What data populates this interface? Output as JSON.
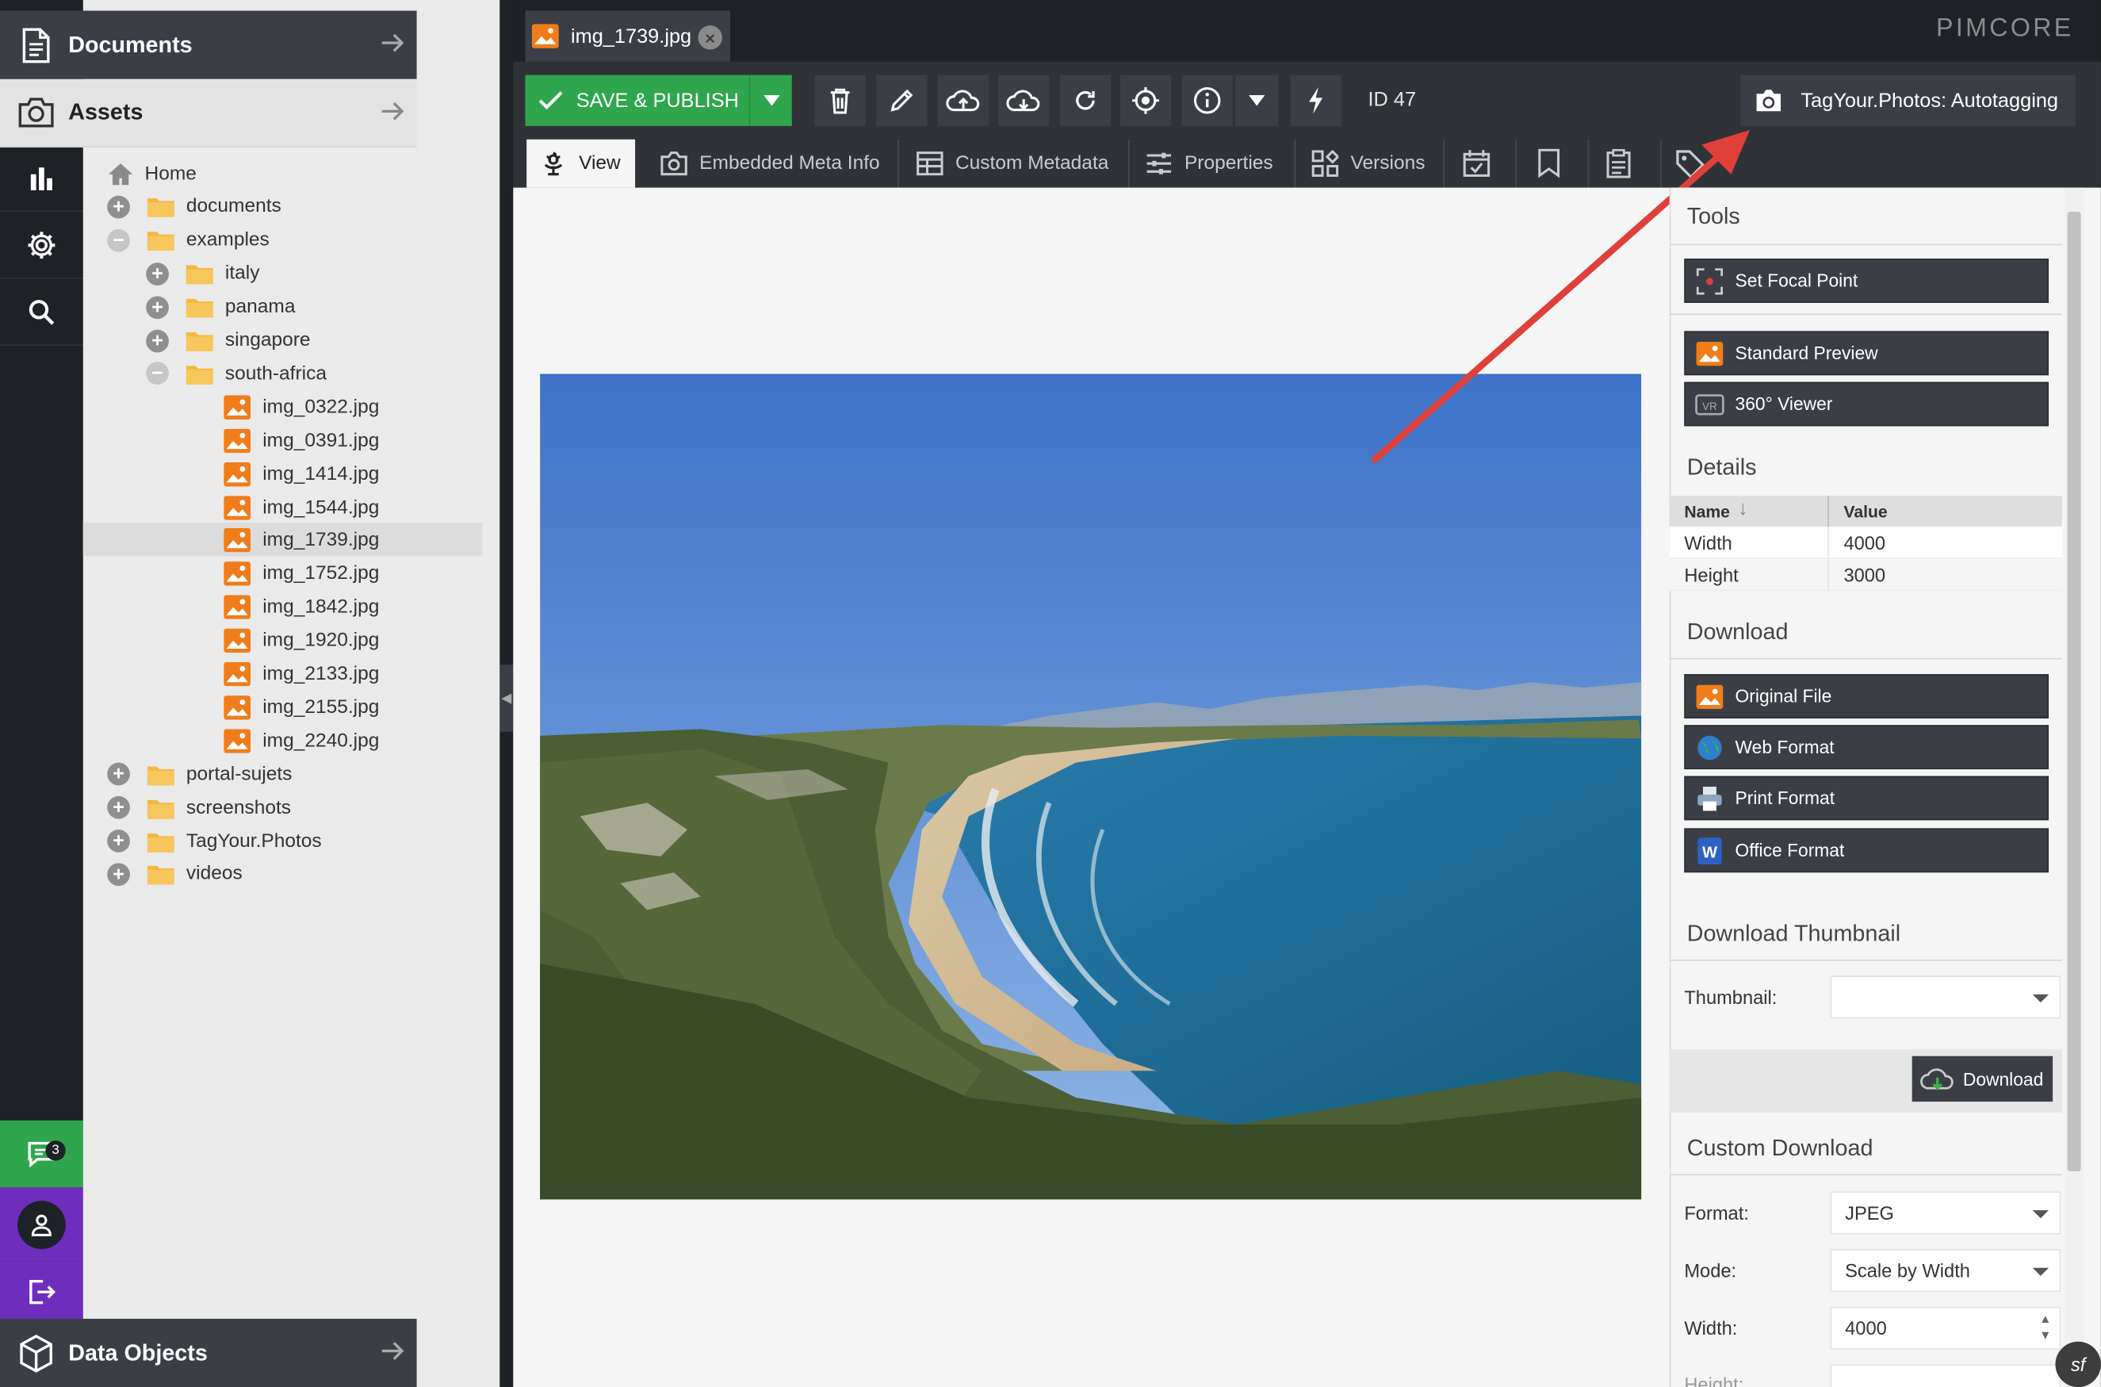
{
  "tab": {
    "title": "img_1739.jpg"
  },
  "brand": {
    "logo": "PIMCORE"
  },
  "left_rail": {
    "items": [
      {
        "icon": "file-icon"
      },
      {
        "icon": "wrench-icon"
      },
      {
        "icon": "chart-icon"
      },
      {
        "icon": "gear-icon"
      },
      {
        "icon": "search-icon"
      }
    ],
    "notifications_count": "3"
  },
  "panels": {
    "documents": "Documents",
    "assets": "Assets",
    "data_objects": "Data Objects"
  },
  "tree": {
    "home": "Home",
    "folders_top": [
      "documents",
      "examples"
    ],
    "examples_children": [
      "italy",
      "panama",
      "singapore",
      "south-africa"
    ],
    "south_africa_files": [
      "img_0322.jpg",
      "img_0391.jpg",
      "img_1414.jpg",
      "img_1544.jpg",
      "img_1739.jpg",
      "img_1752.jpg",
      "img_1842.jpg",
      "img_1920.jpg",
      "img_2133.jpg",
      "img_2155.jpg",
      "img_2240.jpg"
    ],
    "folders_bottom": [
      "portal-sujets",
      "screenshots",
      "TagYour.Photos",
      "videos"
    ],
    "selected": "img_1739.jpg"
  },
  "toolbar": {
    "save_label": "SAVE & PUBLISH",
    "id_label": "ID 47",
    "autotag_label": "TagYour.Photos: Autotagging"
  },
  "subtabs": [
    "View",
    "Embedded Meta Info",
    "Custom Metadata",
    "Properties",
    "Versions"
  ],
  "sidebar": {
    "tools_title": "Tools",
    "set_focal_point": "Set Focal Point",
    "standard_preview": "Standard Preview",
    "viewer_360": "360° Viewer",
    "details_title": "Details",
    "details_headers": {
      "name": "Name",
      "value": "Value"
    },
    "details_rows": [
      {
        "name": "Width",
        "value": "4000"
      },
      {
        "name": "Height",
        "value": "3000"
      }
    ],
    "download_title": "Download",
    "original_file": "Original File",
    "web_format": "Web Format",
    "print_format": "Print Format",
    "office_format": "Office Format",
    "thumb_title": "Download Thumbnail",
    "thumbnail_label": "Thumbnail:",
    "thumbnail_value": "",
    "download_btn": "Download",
    "custom_title": "Custom Download",
    "format_label": "Format:",
    "format_value": "JPEG",
    "mode_label": "Mode:",
    "mode_value": "Scale by Width",
    "width_label": "Width:",
    "width_value": "4000",
    "height_label": "Height:"
  },
  "colors": {
    "save_green": "#2fa64e",
    "dark_toolbar": "#2f3338",
    "button_dark": "#3b3f45",
    "accent_purple": "#6f2dbd",
    "arrow_red": "#e0403a",
    "image_orange": "#f07d1a"
  }
}
